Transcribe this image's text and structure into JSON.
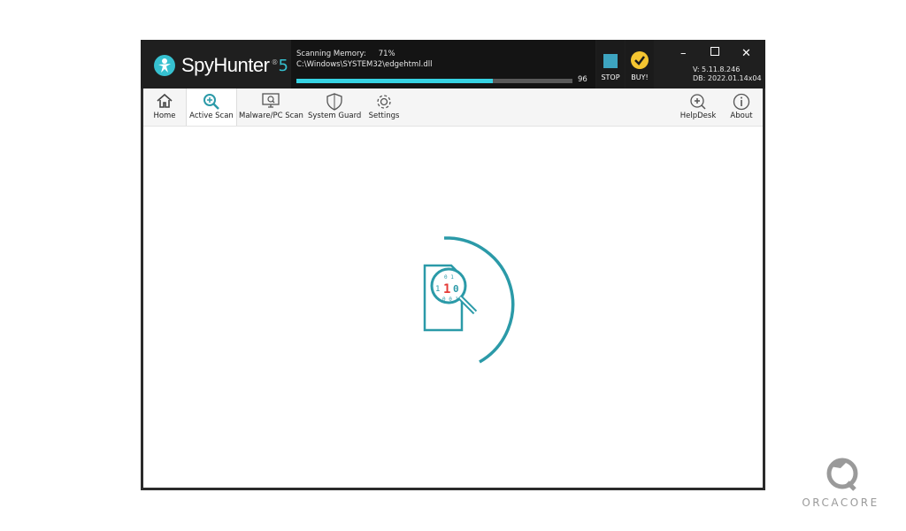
{
  "app": {
    "name": "SpyHunter",
    "version_mark": "5",
    "version_text": "V: 5.11.8.246",
    "db_text": "DB: 2022.01.14x04"
  },
  "scan": {
    "label": "Scanning Memory:",
    "percent_text": "71%",
    "path": "C:\\Windows\\SYSTEM32\\edgehtml.dll",
    "progress_fraction": 0.71,
    "count": "96"
  },
  "actions": {
    "stop_label": "STOP",
    "buy_label": "BUY!"
  },
  "toolbar": {
    "home": "Home",
    "active_scan": "Active Scan",
    "malware_scan": "Malware/PC Scan",
    "system_guard": "System Guard",
    "settings": "Settings",
    "helpdesk": "HelpDesk",
    "about": "About"
  },
  "watermark": {
    "text": "ORCACORE"
  },
  "colors": {
    "accent": "#36c1d0",
    "scan_graphic": "#2b9aa8",
    "buy": "#f4c531",
    "stop": "#3da4c0"
  },
  "icons": [
    "spyhunter-logo-icon",
    "stop-icon",
    "buy-check-icon",
    "minimize-icon",
    "maximize-icon",
    "close-icon",
    "home-icon",
    "active-scan-icon",
    "malware-scan-icon",
    "system-guard-shield-icon",
    "settings-gear-icon",
    "helpdesk-icon",
    "about-info-icon",
    "scanning-document-icon",
    "orcacore-logo-icon"
  ]
}
